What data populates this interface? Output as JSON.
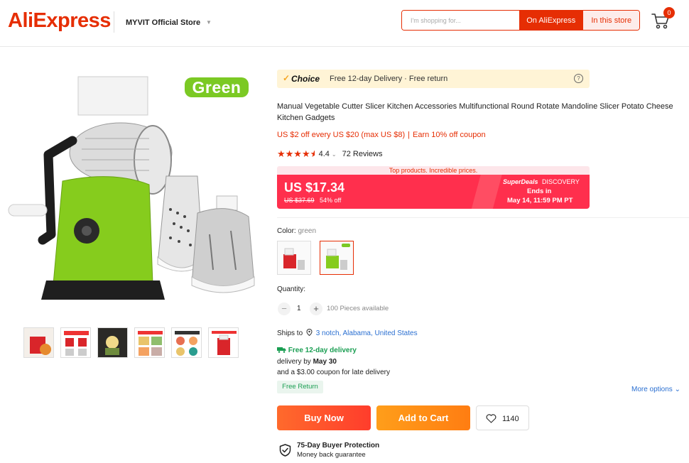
{
  "header": {
    "logo_text": "AliExpress",
    "store_name": "MYVIT Official Store",
    "search_placeholder": "I'm shopping for...",
    "search_on_aliexpress": "On AliExpress",
    "search_in_store": "In this store",
    "cart_count": "0"
  },
  "gallery": {
    "color_badge": "Green",
    "thumbnails": [
      "thumb-1",
      "thumb-2",
      "thumb-3",
      "thumb-4",
      "thumb-5",
      "thumb-6"
    ]
  },
  "choice": {
    "check": "✓",
    "label": "Choice",
    "text": "Free 12-day Delivery · Free return",
    "help": "?"
  },
  "product": {
    "title": "Manual Vegetable Cutter Slicer Kitchen Accessories Multifunctional Round Rotate Mandoline Slicer Potato Cheese Kitchen Gadgets",
    "coupon_text": "US $2 off every US $20 (max US $8)",
    "coupon_sep": "|",
    "coupon_earn": "Earn 10% off coupon",
    "rating": "4.4",
    "reviews": "72 Reviews"
  },
  "price": {
    "banner": "Top products. Incredible prices.",
    "current": "US $17.34",
    "original": "US $37.69",
    "discount": "54% off",
    "deals_brand": "SuperDeals",
    "deals_disc": "DISCOVERY",
    "ends_label": "Ends in",
    "ends_date": "May 14, 11:59 PM PT"
  },
  "variant": {
    "label": "Color: ",
    "selected": "green",
    "options": [
      "red",
      "green"
    ]
  },
  "quantity": {
    "label": "Quantity:",
    "value": "1",
    "available": "100 Pieces available"
  },
  "shipping": {
    "ships_to_label": "Ships to",
    "location": "3 notch, Alabama, United States",
    "free_delivery": "Free 12-day delivery",
    "delivery_by_label": "delivery by",
    "delivery_date": "May 30",
    "late_coupon": "and a $3.00 coupon for late delivery",
    "free_return": "Free Return",
    "more_options": "More options"
  },
  "actions": {
    "buy_now": "Buy Now",
    "add_to_cart": "Add to Cart",
    "wishlist_count": "1140"
  },
  "protection": {
    "title": "75-Day Buyer Protection",
    "subtitle": "Money back guarantee"
  },
  "colors": {
    "brand_red": "#e62e04",
    "price_bar": "#ff2f4d",
    "product_green": "#7bc924",
    "link_blue": "#2a6fd1",
    "success_green": "#1a9e52"
  }
}
